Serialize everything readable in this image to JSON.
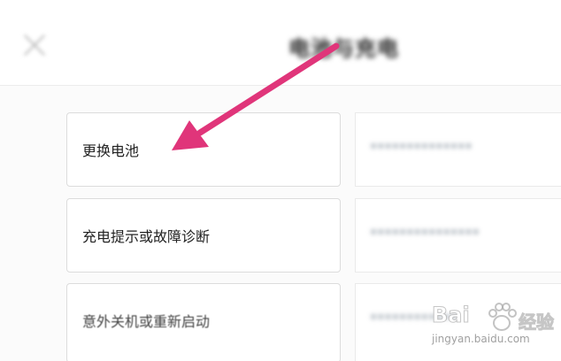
{
  "header": {
    "title": "电池与充电",
    "close_icon": "close-icon"
  },
  "items": [
    {
      "label": "更换电池",
      "detail": "••••••••••••••"
    },
    {
      "label": "充电提示或故障诊断",
      "detail": "•••••••••••••••"
    },
    {
      "label": "意外关机或重新启动",
      "detail": "••••••••••••"
    }
  ],
  "annotation": {
    "arrow_color": "#e0357a"
  },
  "watermark": {
    "brand": "Bai",
    "product": "经验",
    "url": "jingyan.baidu.com"
  }
}
